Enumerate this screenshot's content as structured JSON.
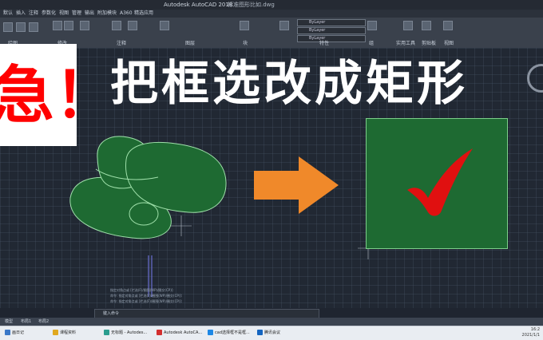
{
  "window": {
    "title": "Autodesk AutoCAD 2018",
    "file": "标准图形比如.dwg"
  },
  "tabs": [
    "默认",
    "插入",
    "注释",
    "参数化",
    "视图",
    "管理",
    "输出",
    "附加模块",
    "A360",
    "精选应用"
  ],
  "ribbon": {
    "panels": [
      "绘图",
      "修改",
      "注释",
      "图层",
      "块",
      "特性",
      "组",
      "实用工具",
      "剪贴板",
      "视图"
    ],
    "layer_combo": "ByLayer",
    "color_combo": "ByLayer",
    "linetype_combo": "ByLayer"
  },
  "headline": "把框选改成矩形",
  "urgent": "急！",
  "command": {
    "history": [
      "指定对角点或 [栏选(F)/圈围(WP)/圈交(CP)]:",
      "命令: 指定对角点或 [栏选(F)/圈围(WP)/圈交(CP)]:",
      "命令: 指定对角点或 [栏选(F)/圈围(WP)/圈交(CP)]:"
    ],
    "input": "键入命令"
  },
  "layout_tabs": [
    "模型",
    "布局1",
    "布局2"
  ],
  "taskbar": {
    "items": [
      {
        "label": "画日记",
        "color": "#3a78c8"
      },
      {
        "label": "课程资料",
        "color": "#e0a820"
      },
      {
        "label": "无标题 - Autodes...",
        "color": "#2a9d8f"
      },
      {
        "label": "Autodesk AutoCA...",
        "color": "#d32f2f"
      },
      {
        "label": "cad选择框不是框...",
        "color": "#1e88e5"
      },
      {
        "label": "腾讯会议",
        "color": "#1565c0"
      }
    ],
    "time": "16:2",
    "date": "2021/1/1"
  },
  "colors": {
    "arrow": "#f0892a",
    "check": "#e01010",
    "shape_fill": "#1e6a32"
  }
}
